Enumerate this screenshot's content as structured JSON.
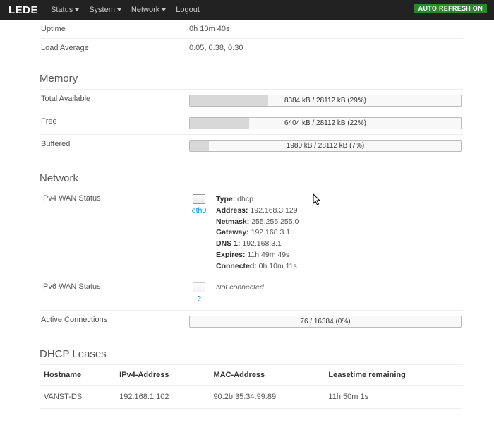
{
  "navbar": {
    "brand": "LEDE",
    "items": [
      "Status",
      "System",
      "Network",
      "Logout"
    ],
    "refresh": "AUTO REFRESH ON"
  },
  "system": {
    "uptime": {
      "label": "Uptime",
      "value": "0h 10m 40s"
    },
    "load": {
      "label": "Load Average",
      "value": "0.05, 0.38, 0.30"
    }
  },
  "memory": {
    "title": "Memory",
    "total": {
      "label": "Total Available",
      "text": "8384 kB / 28112 kB (29%)",
      "pct": 29
    },
    "free": {
      "label": "Free",
      "text": "6404 kB / 28112 kB (22%)",
      "pct": 22
    },
    "buffered": {
      "label": "Buffered",
      "text": "1980 kB / 28112 kB (7%)",
      "pct": 7
    }
  },
  "network": {
    "title": "Network",
    "ipv4": {
      "label": "IPv4 WAN Status",
      "iface": "eth0",
      "lines": [
        {
          "k": "Type:",
          "v": " dhcp"
        },
        {
          "k": "Address:",
          "v": " 192.168.3.129"
        },
        {
          "k": "Netmask:",
          "v": " 255.255.255.0"
        },
        {
          "k": "Gateway:",
          "v": " 192.168.3.1"
        },
        {
          "k": "DNS 1:",
          "v": " 192.168.3.1"
        },
        {
          "k": "Expires:",
          "v": " 11h 49m 49s"
        },
        {
          "k": "Connected:",
          "v": " 0h 10m 11s"
        }
      ]
    },
    "ipv6": {
      "label": "IPv6 WAN Status",
      "iface": "?",
      "status": "Not connected"
    },
    "conn": {
      "label": "Active Connections",
      "text": "76 / 16384 (0%)",
      "pct": 0
    }
  },
  "dhcp": {
    "title": "DHCP Leases",
    "headers": [
      "Hostname",
      "IPv4-Address",
      "MAC-Address",
      "Leasetime remaining"
    ],
    "rows": [
      {
        "host": "VANST-DS",
        "ip": "192.168.1.102",
        "mac": "90:2b:35:34:99:89",
        "lease": "11h 50m 1s"
      }
    ]
  }
}
